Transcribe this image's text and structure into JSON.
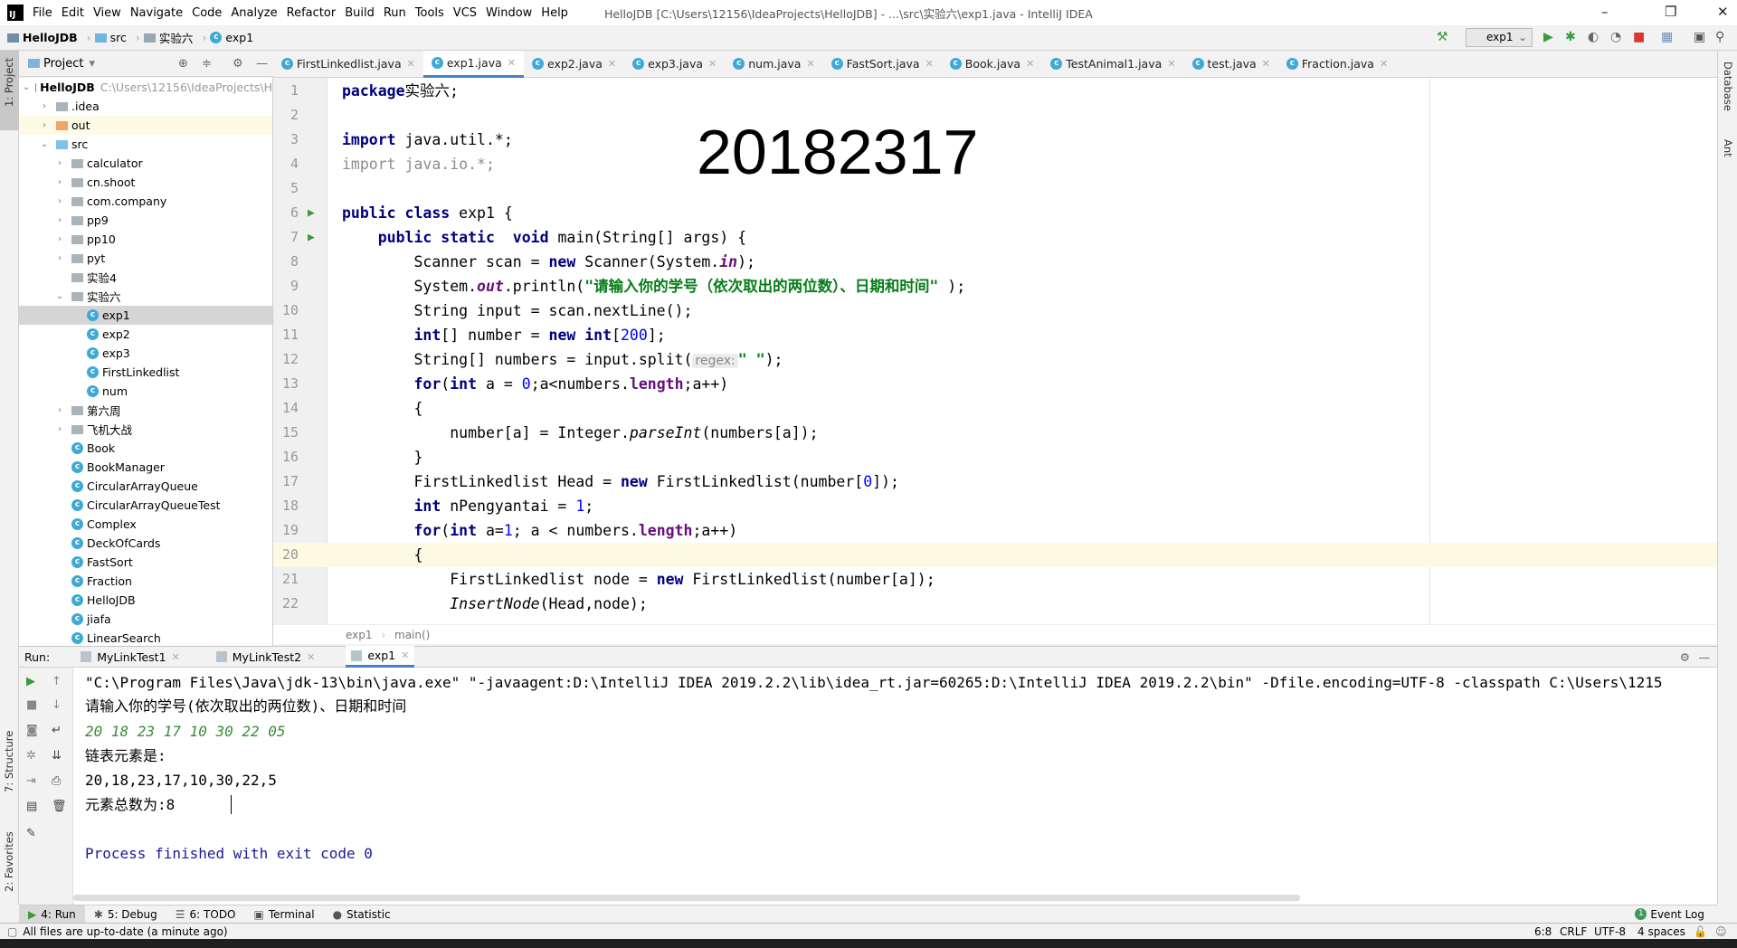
{
  "app": {
    "title": "HelloJDB [C:\\Users\\12156\\IdeaProjects\\HelloJDB] - ...\\src\\实验六\\exp1.java - IntelliJ IDEA",
    "logo": "IJ"
  },
  "menu": [
    "File",
    "Edit",
    "View",
    "Navigate",
    "Code",
    "Analyze",
    "Refactor",
    "Build",
    "Run",
    "Tools",
    "VCS",
    "Window",
    "Help"
  ],
  "navbar": {
    "crumbs": [
      "HelloJDB",
      "src",
      "实验六",
      "exp1"
    ],
    "run_config": "exp1"
  },
  "left_strip": {
    "project": "1: Project",
    "structure": "7: Structure",
    "favorites": "2: Favorites"
  },
  "right_strip": {
    "database": "Database",
    "ant": "Ant"
  },
  "project": {
    "header": "Project",
    "root": {
      "name": "HelloJDB",
      "path": "C:\\Users\\12156\\IdeaProjects\\H"
    },
    "items": [
      {
        "label": ".idea",
        "type": "folder",
        "depth": 1,
        "arrow": "right"
      },
      {
        "label": "out",
        "type": "folder-orange",
        "depth": 1,
        "arrow": "right"
      },
      {
        "label": "src",
        "type": "folder-blue",
        "depth": 1,
        "arrow": "down"
      },
      {
        "label": "calculator",
        "type": "package",
        "depth": 2,
        "arrow": "right"
      },
      {
        "label": "cn.shoot",
        "type": "package",
        "depth": 2,
        "arrow": "right"
      },
      {
        "label": "com.company",
        "type": "package",
        "depth": 2,
        "arrow": "right"
      },
      {
        "label": "pp9",
        "type": "package",
        "depth": 2,
        "arrow": "right"
      },
      {
        "label": "pp10",
        "type": "package",
        "depth": 2,
        "arrow": "right"
      },
      {
        "label": "pyt",
        "type": "package",
        "depth": 2,
        "arrow": "right"
      },
      {
        "label": "实验4",
        "type": "package",
        "depth": 2,
        "arrow": ""
      },
      {
        "label": "实验六",
        "type": "package",
        "depth": 2,
        "arrow": "down"
      },
      {
        "label": "exp1",
        "type": "class",
        "depth": 3,
        "arrow": "",
        "selected": true
      },
      {
        "label": "exp2",
        "type": "class",
        "depth": 3,
        "arrow": ""
      },
      {
        "label": "exp3",
        "type": "class",
        "depth": 3,
        "arrow": ""
      },
      {
        "label": "FirstLinkedlist",
        "type": "class",
        "depth": 3,
        "arrow": ""
      },
      {
        "label": "num",
        "type": "class",
        "depth": 3,
        "arrow": ""
      },
      {
        "label": "第六周",
        "type": "package",
        "depth": 2,
        "arrow": "right"
      },
      {
        "label": "飞机大战",
        "type": "package",
        "depth": 2,
        "arrow": "right"
      },
      {
        "label": "Book",
        "type": "class",
        "depth": 2,
        "arrow": ""
      },
      {
        "label": "BookManager",
        "type": "class",
        "depth": 2,
        "arrow": ""
      },
      {
        "label": "CircularArrayQueue",
        "type": "class",
        "depth": 2,
        "arrow": ""
      },
      {
        "label": "CircularArrayQueueTest",
        "type": "class",
        "depth": 2,
        "arrow": ""
      },
      {
        "label": "Complex",
        "type": "class",
        "depth": 2,
        "arrow": ""
      },
      {
        "label": "DeckOfCards",
        "type": "class",
        "depth": 2,
        "arrow": ""
      },
      {
        "label": "FastSort",
        "type": "class",
        "depth": 2,
        "arrow": ""
      },
      {
        "label": "Fraction",
        "type": "class",
        "depth": 2,
        "arrow": ""
      },
      {
        "label": "HelloJDB",
        "type": "class",
        "depth": 2,
        "arrow": ""
      },
      {
        "label": "jiafa",
        "type": "class",
        "depth": 2,
        "arrow": ""
      },
      {
        "label": "LinearSearch",
        "type": "class",
        "depth": 2,
        "arrow": ""
      }
    ]
  },
  "tabs": [
    {
      "label": "FirstLinkedlist.java"
    },
    {
      "label": "exp1.java",
      "active": true
    },
    {
      "label": "exp2.java"
    },
    {
      "label": "exp3.java"
    },
    {
      "label": "num.java"
    },
    {
      "label": "FastSort.java"
    },
    {
      "label": "Book.java"
    },
    {
      "label": "TestAnimal1.java"
    },
    {
      "label": "test.java"
    },
    {
      "label": "Fraction.java"
    }
  ],
  "editor": {
    "overlay_text": "20182317",
    "current_line": 20,
    "lines": [
      {
        "n": "1",
        "t": [
          [
            "kw",
            "package"
          ],
          [
            "",
            "实验六;"
          ]
        ]
      },
      {
        "n": "2",
        "t": []
      },
      {
        "n": "3",
        "t": [
          [
            "kw",
            "import"
          ],
          [
            "",
            " java.util.*;"
          ]
        ]
      },
      {
        "n": "4",
        "t": [
          [
            "gray",
            "import java.io.*;"
          ]
        ]
      },
      {
        "n": "5",
        "t": []
      },
      {
        "n": "6",
        "run": true,
        "t": [
          [
            "kw",
            "public class"
          ],
          [
            "",
            " exp1 {"
          ]
        ]
      },
      {
        "n": "7",
        "run": true,
        "t": [
          [
            "",
            "    "
          ],
          [
            "kw",
            "public static"
          ],
          [
            "",
            "  "
          ],
          [
            "kw",
            "void"
          ],
          [
            "",
            " main(String[] args) {"
          ]
        ]
      },
      {
        "n": "8",
        "t": [
          [
            "",
            "        Scanner scan = "
          ],
          [
            "kw",
            "new"
          ],
          [
            "",
            " Scanner(System."
          ],
          [
            "fld",
            "in"
          ],
          [
            "",
            ");"
          ]
        ]
      },
      {
        "n": "9",
        "t": [
          [
            "",
            "        System."
          ],
          [
            "fld",
            "out"
          ],
          [
            "",
            ".println("
          ],
          [
            "str",
            "\"请输入你的学号（依次取出的两位数）、日期和时间\""
          ],
          [
            "",
            " );"
          ]
        ]
      },
      {
        "n": "10",
        "t": [
          [
            "",
            "        String input = scan.nextLine();"
          ]
        ]
      },
      {
        "n": "11",
        "t": [
          [
            "",
            "        "
          ],
          [
            "kw",
            "int"
          ],
          [
            "",
            "[] number = "
          ],
          [
            "kw",
            "new int"
          ],
          [
            "",
            "["
          ],
          [
            "num",
            "200"
          ],
          [
            "",
            "];"
          ]
        ]
      },
      {
        "n": "12",
        "t": [
          [
            "",
            "        String[] numbers = input.split("
          ],
          [
            "hint",
            "regex:"
          ],
          [
            "str",
            "\" \""
          ],
          [
            "",
            ");"
          ]
        ]
      },
      {
        "n": "13",
        "t": [
          [
            "",
            "        "
          ],
          [
            "kw",
            "for"
          ],
          [
            "",
            "("
          ],
          [
            "kw",
            "int"
          ],
          [
            "",
            " a = "
          ],
          [
            "num",
            "0"
          ],
          [
            "",
            ";a<numbers."
          ],
          [
            "mem",
            "length"
          ],
          [
            "",
            ";a++)"
          ]
        ]
      },
      {
        "n": "14",
        "t": [
          [
            "",
            "        {"
          ]
        ]
      },
      {
        "n": "15",
        "t": [
          [
            "",
            "            number[a] = Integer."
          ],
          [
            "it",
            "parseInt"
          ],
          [
            "",
            "(numbers[a]);"
          ]
        ]
      },
      {
        "n": "16",
        "t": [
          [
            "",
            "        }"
          ]
        ]
      },
      {
        "n": "17",
        "t": [
          [
            "",
            "        FirstLinkedlist Head = "
          ],
          [
            "kw",
            "new"
          ],
          [
            "",
            " FirstLinkedlist(number["
          ],
          [
            "num",
            "0"
          ],
          [
            "",
            "]);"
          ]
        ]
      },
      {
        "n": "18",
        "t": [
          [
            "",
            "        "
          ],
          [
            "kw",
            "int"
          ],
          [
            "",
            " nPengyantai = "
          ],
          [
            "num",
            "1"
          ],
          [
            "",
            ";"
          ]
        ]
      },
      {
        "n": "19",
        "t": [
          [
            "",
            "        "
          ],
          [
            "kw",
            "for"
          ],
          [
            "",
            "("
          ],
          [
            "kw",
            "int"
          ],
          [
            "",
            " a="
          ],
          [
            "num",
            "1"
          ],
          [
            "",
            "; a < numbers."
          ],
          [
            "mem",
            "length"
          ],
          [
            "",
            ";a++)"
          ]
        ]
      },
      {
        "n": "20",
        "t": [
          [
            "",
            "        {"
          ]
        ]
      },
      {
        "n": "21",
        "t": [
          [
            "",
            "            FirstLinkedlist node = "
          ],
          [
            "kw",
            "new"
          ],
          [
            "",
            " FirstLinkedlist(number[a]);"
          ]
        ]
      },
      {
        "n": "22",
        "t": [
          [
            "",
            "            "
          ],
          [
            "it",
            "InsertNode"
          ],
          [
            "",
            "(Head,node);"
          ]
        ]
      }
    ],
    "breadcrumb": [
      "exp1",
      "main()"
    ]
  },
  "run": {
    "label": "Run:",
    "tabs": [
      {
        "label": "MyLinkTest1"
      },
      {
        "label": "MyLinkTest2"
      },
      {
        "label": "exp1",
        "active": true
      }
    ],
    "output": [
      {
        "cls": "",
        "text": "\"C:\\Program Files\\Java\\jdk-13\\bin\\java.exe\" \"-javaagent:D:\\IntelliJ IDEA 2019.2.2\\lib\\idea_rt.jar=60265:D:\\IntelliJ IDEA 2019.2.2\\bin\" -Dfile.encoding=UTF-8 -classpath C:\\Users\\1215"
      },
      {
        "cls": "",
        "text": "请输入你的学号(依次取出的两位数)、日期和时间"
      },
      {
        "cls": "green",
        "text": "20 18 23 17 10 30 22 05"
      },
      {
        "cls": "",
        "text": "链表元素是:"
      },
      {
        "cls": "",
        "text": "20,18,23,17,10,30,22,5"
      },
      {
        "cls": "",
        "text": "元素总数为:8"
      },
      {
        "cls": "",
        "text": ""
      },
      {
        "cls": "blue",
        "text": "Process finished with exit code 0"
      }
    ]
  },
  "bottom_tools": [
    {
      "label": "4: Run",
      "active": true
    },
    {
      "label": "5: Debug"
    },
    {
      "label": "6: TODO"
    },
    {
      "label": "Terminal"
    },
    {
      "label": "Statistic"
    }
  ],
  "event_log": {
    "count": "1",
    "label": "Event Log"
  },
  "status": {
    "message": "All files are up-to-date (a minute ago)",
    "position": "6:8",
    "line_sep": "CRLF",
    "encoding": "UTF-8",
    "indent": "4 spaces"
  },
  "colors": {
    "accent": "#4083c9",
    "keyword": "#000080",
    "string": "#067d17",
    "current_line": "#fdf9e2"
  }
}
